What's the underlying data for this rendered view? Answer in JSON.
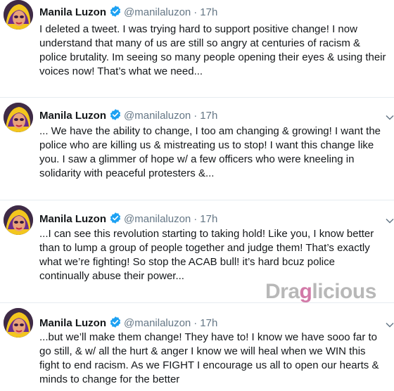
{
  "tweets": [
    {
      "author": "Manila Luzon",
      "handle": "@manilaluzon",
      "separator": "·",
      "time": "17h",
      "text": "I deleted a tweet. I was trying hard to support positive change! I now\nunderstand that many of us are still so angry at centuries of racism &\npolice brutality. Im seeing so many people opening their eyes & using their\nvoices now! That’s what we need..."
    },
    {
      "author": "Manila Luzon",
      "handle": "@manilaluzon",
      "separator": "·",
      "time": "17h",
      "text": "... We have the ability to change, I too am changing & growing! I want the\npolice who are killing us & mistreating us to stop! I want this change like\nyou. I saw a glimmer of hope w/ a few officers who were kneeling in\nsolidarity with peaceful protesters &..."
    },
    {
      "author": "Manila Luzon",
      "handle": "@manilaluzon",
      "separator": "·",
      "time": "17h",
      "text": "...I can see this revolution starting to taking hold! Like you, I know better\nthan to lump a group of people together and judge them! That’s exactly\nwhat we’re fighting! So stop the ACAB bull! it’s hard bcuz police\ncontinually abuse their power..."
    },
    {
      "author": "Manila Luzon",
      "handle": "@manilaluzon",
      "separator": "·",
      "time": "17h",
      "text": "...but we’ll make them change! They have to! I know we have sooo far to\ngo still, & w/ all the hurt & anger I know we will heal when we WIN this\nfight to end racism. As we FIGHT I encourage us all to open our hearts &\nminds to change for the better"
    }
  ],
  "watermark": {
    "part1": "Dra",
    "part2": "g",
    "part3": "licious"
  },
  "colors": {
    "verified": "#1da1f2",
    "secondary_text": "#657786",
    "divider": "#e6ecf0"
  },
  "icons": {
    "verified": "verified-badge-icon",
    "menu": "chevron-down-icon"
  }
}
